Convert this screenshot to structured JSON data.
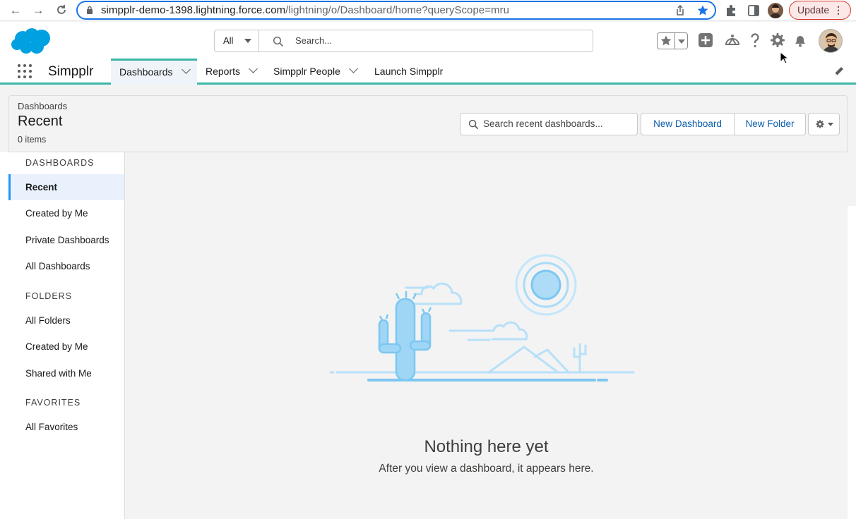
{
  "browser": {
    "url_host": "simpplr-demo-1398.lightning.force.com",
    "url_path": "/lightning/o/Dashboard/home?queryScope=mru",
    "update_label": "Update",
    "icons": [
      "back-arrow-icon",
      "forward-arrow-icon",
      "reload-icon",
      "lock-icon",
      "share-icon",
      "bookmark-star-icon",
      "extensions-icon",
      "side-panel-icon",
      "profile-avatar-icon",
      "more-vert-icon"
    ]
  },
  "header": {
    "search_scope": "All",
    "search_placeholder": "Search...",
    "icons": [
      "salesforce-cloud-logo",
      "favorites-star-icon",
      "global-create-icon",
      "trailhead-icon",
      "help-icon",
      "setup-gear-icon",
      "notifications-bell-icon",
      "user-avatar"
    ]
  },
  "nav": {
    "app_name": "Simpplr",
    "tabs": [
      {
        "label": "Dashboards",
        "active": true,
        "has_menu": true
      },
      {
        "label": "Reports",
        "active": false,
        "has_menu": true
      },
      {
        "label": "Simpplr People",
        "active": false,
        "has_menu": true
      },
      {
        "label": "Launch Simpplr",
        "active": false,
        "has_menu": false
      }
    ]
  },
  "page_header": {
    "breadcrumb": "Dashboards",
    "title": "Recent",
    "count": "0 items",
    "search_placeholder": "Search recent dashboards...",
    "new_dashboard_label": "New Dashboard",
    "new_folder_label": "New Folder"
  },
  "sidebar": {
    "dashboards_heading": "DASHBOARDS",
    "dashboards_items": [
      "Recent",
      "Created by Me",
      "Private Dashboards",
      "All Dashboards"
    ],
    "folders_heading": "FOLDERS",
    "folders_items": [
      "All Folders",
      "Created by Me",
      "Shared with Me"
    ],
    "favorites_heading": "FAVORITES",
    "favorites_items": [
      "All Favorites"
    ],
    "active_item": "Recent"
  },
  "empty_state": {
    "title": "Nothing here yet",
    "subtitle": "After you view a dashboard, it appears here."
  },
  "colors": {
    "accent_teal": "#3bb5a6",
    "link_blue": "#0b5cab",
    "brand_blue": "#1b96ff",
    "illustration_blue": "#8fd0f5"
  }
}
